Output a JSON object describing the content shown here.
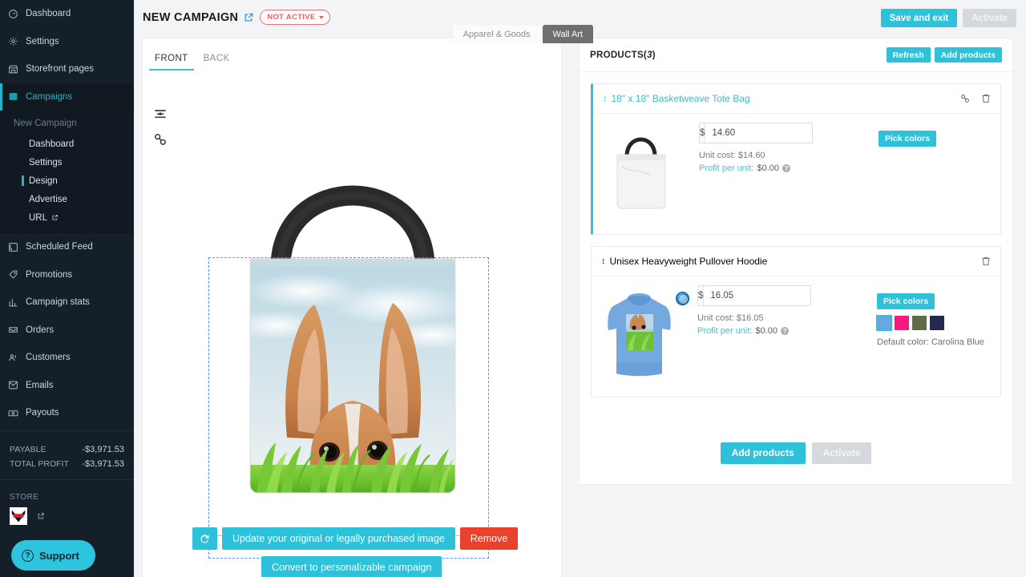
{
  "sidebar": {
    "nav": [
      {
        "label": "Dashboard",
        "icon": "speedometer-icon"
      },
      {
        "label": "Settings",
        "icon": "gear-icon"
      },
      {
        "label": "Storefront pages",
        "icon": "store-icon"
      },
      {
        "label": "Campaigns",
        "icon": "campaign-icon",
        "active": true
      }
    ],
    "sub_title": "New Campaign",
    "sub_items": [
      {
        "label": "Dashboard"
      },
      {
        "label": "Settings"
      },
      {
        "label": "Design",
        "active": true
      },
      {
        "label": "Advertise"
      },
      {
        "label": "URL",
        "external": true
      }
    ],
    "nav2": [
      {
        "label": "Scheduled Feed",
        "icon": "feed-icon"
      },
      {
        "label": "Promotions",
        "icon": "tag-icon"
      },
      {
        "label": "Campaign stats",
        "icon": "bar-chart-icon"
      },
      {
        "label": "Orders",
        "icon": "inbox-icon"
      },
      {
        "label": "Customers",
        "icon": "users-icon"
      },
      {
        "label": "Emails",
        "icon": "envelope-icon"
      },
      {
        "label": "Payouts",
        "icon": "money-icon"
      }
    ],
    "payable_label": "PAYABLE",
    "payable_value": "-$3,971.53",
    "total_profit_label": "TOTAL PROFIT",
    "total_profit_value": "-$3,971.53",
    "store_label": "STORE",
    "support_label": "Support"
  },
  "header": {
    "title": "NEW CAMPAIGN",
    "status_badge": "NOT ACTIVE",
    "save_and_exit": "Save and exit",
    "activate": "Activate"
  },
  "category_tabs": [
    {
      "label": "Apparel & Goods",
      "selected": false
    },
    {
      "label": "Wall Art",
      "selected": true
    }
  ],
  "design": {
    "side_tabs": [
      {
        "label": "FRONT",
        "active": true
      },
      {
        "label": "BACK",
        "active": false
      }
    ],
    "tools": [
      "align-icon",
      "link-icon"
    ],
    "refresh_icon": "refresh-icon",
    "update_label": "Update your original or legally purchased image",
    "remove_label": "Remove",
    "convert_label": "Convert to personalizable campaign"
  },
  "products": {
    "panel_title_prefix": "PRODUCTS(",
    "panel_title_count": "3",
    "panel_title_suffix": ")",
    "refresh_label": "Refresh",
    "add_products_label": "Add products",
    "footer_add_products": "Add products",
    "footer_activate": "Activate",
    "items": [
      {
        "name": "18\" x 18\" Basketweave Tote Bag",
        "selected": true,
        "currency_symbol": "$",
        "price": "14.60",
        "unit_cost": "Unit cost: $14.60",
        "profit_label": "Profit per unit:",
        "profit_value": "$0.00",
        "pick_colors_label": "Pick colors",
        "swatches": [],
        "default_color": "",
        "has_link_icon": true,
        "has_trash_icon": true
      },
      {
        "name": "Unisex Heavyweight Pullover Hoodie",
        "selected": false,
        "currency_symbol": "$",
        "price": "16.05",
        "unit_cost": "Unit cost: $16.05",
        "profit_label": "Profit per unit:",
        "profit_value": "$0.00",
        "pick_colors_label": "Pick colors",
        "swatches": [
          "#6aa7e0",
          "#f51a7b",
          "#5e6b45",
          "#25294f"
        ],
        "default_color": "Default color: Carolina Blue",
        "has_link_icon": false,
        "has_trash_icon": true
      }
    ]
  },
  "colors": {
    "accent_teal": "#2ec2da",
    "danger_red": "#e8412c",
    "status_red": "#ef5d66",
    "sidebar_bg": "#151f29"
  }
}
